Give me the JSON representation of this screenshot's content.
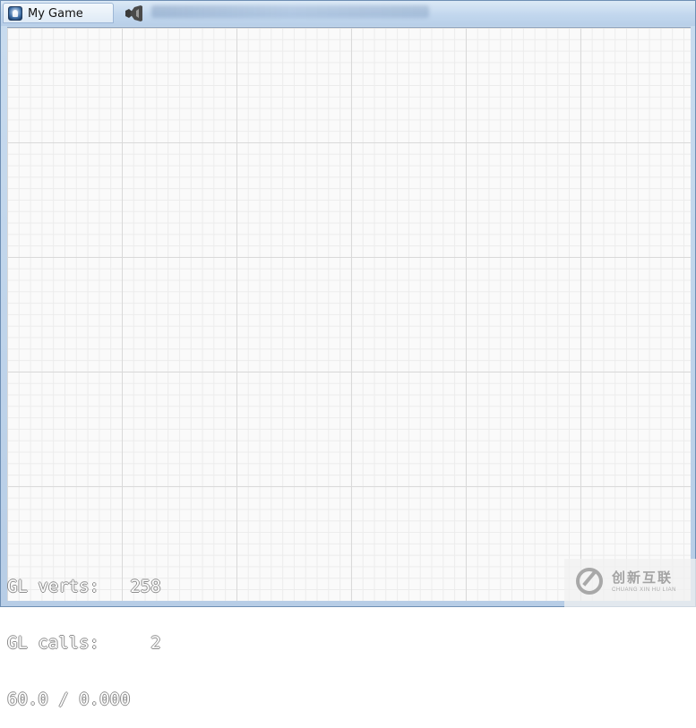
{
  "window": {
    "title": "My Game"
  },
  "taskbar": {
    "background_app_icon": "visual-studio-icon"
  },
  "overlay_stats": {
    "lines": [
      "GL verts:   258",
      "GL calls:     2",
      "60.0 / 0.000"
    ]
  },
  "watermark": {
    "brand_cn": "创新互联",
    "brand_en": "CHUANG XIN HU LIAN"
  },
  "colors": {
    "grid_major": "#d9d9d9",
    "grid_minor": "#ececec",
    "canvas_bg": "#fafafa",
    "stats_text": "#ffffff",
    "stats_outline": "#8c8c8c"
  }
}
